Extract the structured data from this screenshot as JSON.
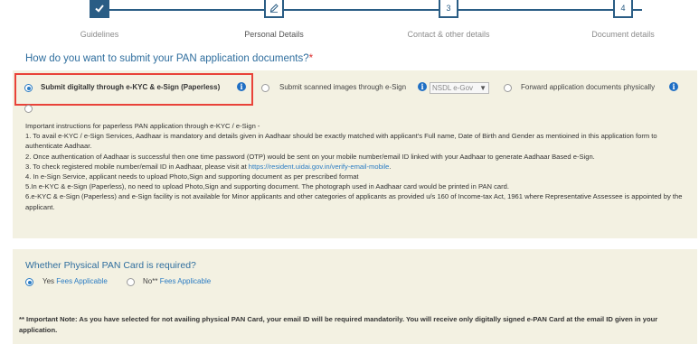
{
  "stepper": {
    "steps": [
      {
        "number": "",
        "label": "Guidelines",
        "state": "done",
        "icon": "check-icon"
      },
      {
        "number": "",
        "label": "Personal Details",
        "state": "current",
        "icon": "pencil-icon"
      },
      {
        "number": "3",
        "label": "Contact & other details",
        "state": "pending"
      },
      {
        "number": "4",
        "label": "Document details",
        "state": "pending"
      }
    ]
  },
  "submission": {
    "question": "How do you want to submit your PAN application documents?",
    "required_mark": "*",
    "options": [
      {
        "label": "Submit digitally through e-KYC & e-Sign (Paperless)",
        "selected": true
      },
      {
        "label": "Submit scanned images through e-Sign",
        "selected": false
      },
      {
        "label": "Forward application documents physically",
        "selected": false
      }
    ],
    "esign_provider": "NSDL e-Gov"
  },
  "instructions": {
    "heading": "Important instructions for paperless PAN application through e-KYC / e-Sign -",
    "items": [
      "1. To avail e-KYC / e-Sign Services, Aadhaar is mandatory and details given in Aadhaar should be exactly matched with applicant's Full name, Date of Birth and Gender as mentioined in this application form to authenticate Aadhaar.",
      "2. Once authentication of Aadhaar is successful then one time password (OTP) would be sent on your mobile number/email ID linked with your Aadhaar to generate Aadhaar Based e-Sign."
    ],
    "item3_prefix": "3. To check registered mobile number/email ID in Aadhaar, please visit at ",
    "item3_link": "https://resident.uidai.gov.in/verify-email-mobile",
    "item3_suffix": ".",
    "items_rest": [
      "4. In e-Sign Service, applicant needs to upload Photo,Sign and supporting document as per prescribed format",
      "5.In e-KYC & e-Sign (Paperless), no need to upload Photo,Sign and supporting document. The photograph used in Aadhaar card would be printed in PAN card.",
      "6.e-KYC & e-Sign (Paperless) and e-Sign facility is not available for Minor applicants and other categories of applicants as provided u/s 160 of Income-tax Act, 1961 where Representative Assessee is appointed by the applicant."
    ]
  },
  "physical_card": {
    "question": "Whether Physical PAN Card is required?",
    "yes_label": "Yes",
    "yes_fees": "Fees Applicable",
    "yes_selected": true,
    "no_label": "No**",
    "no_fees": "Fees Applicable",
    "no_selected": false
  },
  "note": "** Important Note: As you have selected for not availing physical PAN Card, your email ID will be required mandatorily. You will receive only digitally signed e-PAN Card at the email ID given in your application.",
  "colors": {
    "accent": "#2a5d85",
    "link": "#2b7cc3",
    "panel_bg": "#f3f1e2",
    "highlight": "#e94339"
  }
}
